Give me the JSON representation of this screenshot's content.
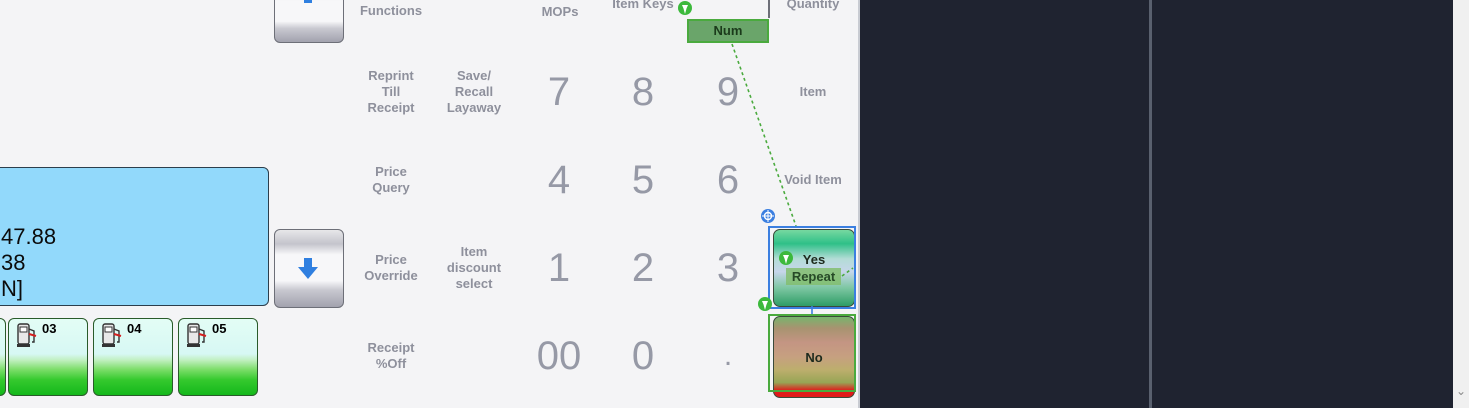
{
  "header_row": {
    "functions": "Functions",
    "mops": "MOPs",
    "item_keys": "Item Keys",
    "quantity": "Quantity"
  },
  "function_keys": {
    "reprint": "Reprint\nTill\nReceipt",
    "save_recall": "Save/\nRecall\nLayaway",
    "item": "Item",
    "price_query": "Price\nQuery",
    "void_item": "Void Item",
    "price_override": "Price\nOverride",
    "item_discount": "Item\ndiscount\nselect",
    "receipt_off": "Receipt\n%Off"
  },
  "numpad": {
    "k7": "7",
    "k8": "8",
    "k9": "9",
    "k4": "4",
    "k5": "5",
    "k6": "6",
    "k1": "1",
    "k2": "2",
    "k3": "3",
    "k00": "00",
    "k0": "0",
    "dot": "."
  },
  "amount_display": {
    "line1": "47.88",
    "line2": "38",
    "line3": "N]"
  },
  "pumps": [
    {
      "number": "03"
    },
    {
      "number": "04"
    },
    {
      "number": "05"
    }
  ],
  "buttons": {
    "yes": "Yes",
    "no": "No",
    "num_tag": "Num",
    "repeat_tag": "Repeat"
  },
  "colors": {
    "amount_bg": "#92d9fb",
    "selection_green": "#4aaa3e",
    "selection_blue": "#3b7fe0",
    "dark_panel": "#1f2330"
  },
  "icons": {
    "scroll_arrow": "⌄"
  }
}
